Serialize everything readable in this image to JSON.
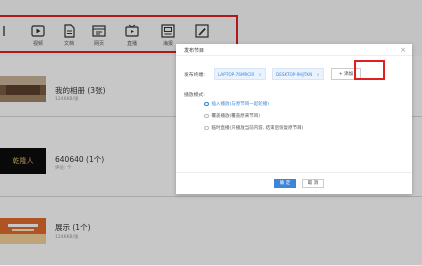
{
  "toolbar": {
    "items": [
      {
        "label": "",
        "icon": "partial-icon"
      },
      {
        "label": "视频",
        "icon": "video-icon"
      },
      {
        "label": "文档",
        "icon": "document-icon"
      },
      {
        "label": "网页",
        "icon": "webpage-icon"
      },
      {
        "label": "直播",
        "icon": "live-tv-icon"
      },
      {
        "label": "海报",
        "icon": "poster-icon"
      },
      {
        "label": "",
        "icon": "edit-icon"
      }
    ]
  },
  "list": {
    "rows": [
      {
        "title": "我的相册 (3张)",
        "sub": "1246KB/张"
      },
      {
        "title": "640640 (1个)",
        "sub": "评论: 个"
      },
      {
        "title": "展示 (1个)",
        "sub": "1246KB/张"
      }
    ],
    "thumb2_text": "乾隆人"
  },
  "dialog": {
    "title": "发布节目",
    "close": "×",
    "terminal_label": "发布终端:",
    "terminals": [
      "LAPTOP-76MRCIR",
      "DESKTOP-9HJTKN"
    ],
    "tag_remove": "×",
    "add_label": "+ 添加",
    "mode_label": "播放模式:",
    "modes": [
      {
        "label": "插入播放(与原节目一起轮播)",
        "selected": true
      },
      {
        "label": "覆盖播放(覆盖原来节目)",
        "selected": false
      },
      {
        "label": "临时直播(只播放当前内容, 结束后恢复原节目)",
        "selected": false
      }
    ],
    "ok": "确 定",
    "cancel": "取 消"
  },
  "colors": {
    "accent": "#3b86d9",
    "highlight": "#e02020"
  }
}
